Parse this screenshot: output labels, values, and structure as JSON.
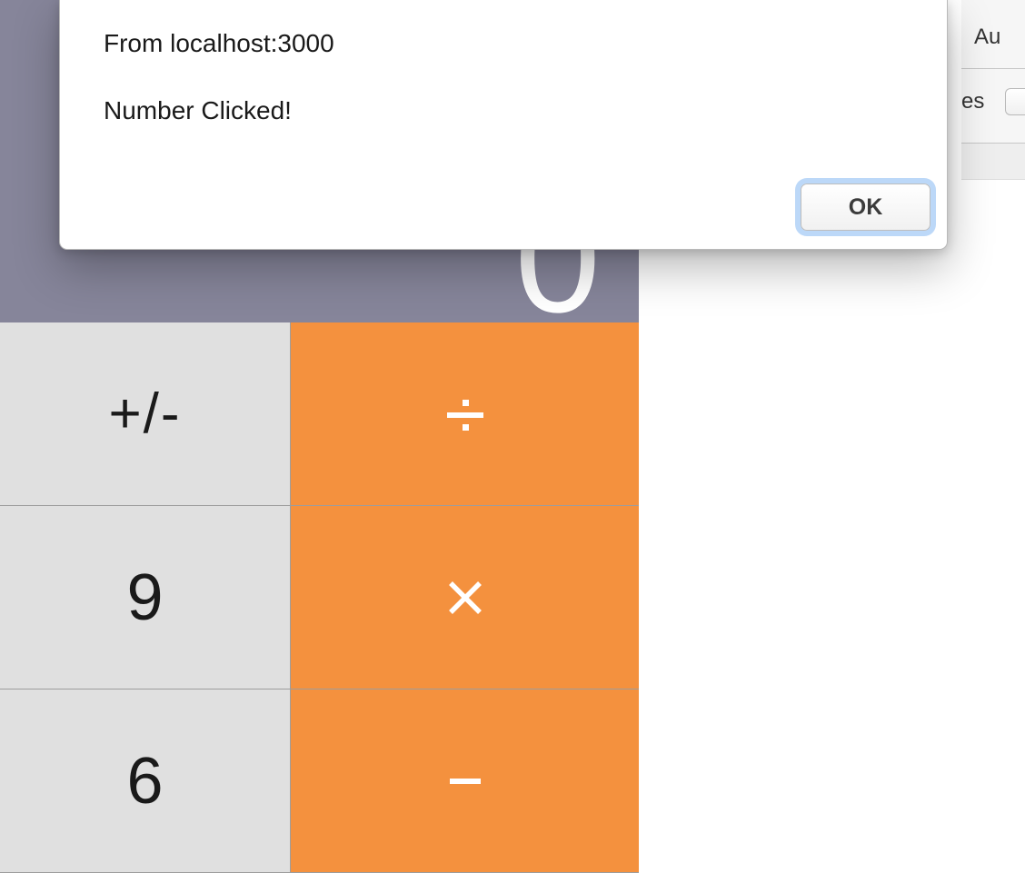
{
  "devtools": {
    "tab_partial": "Au",
    "toolbar_partial": "es"
  },
  "calculator": {
    "display_value": "0",
    "keys": {
      "sign": "+/-",
      "divide": "÷",
      "nine": "9",
      "multiply": "×",
      "six": "6",
      "minus": "-"
    }
  },
  "alert": {
    "title": "From localhost:3000",
    "message": "Number Clicked!",
    "ok_label": "OK"
  }
}
